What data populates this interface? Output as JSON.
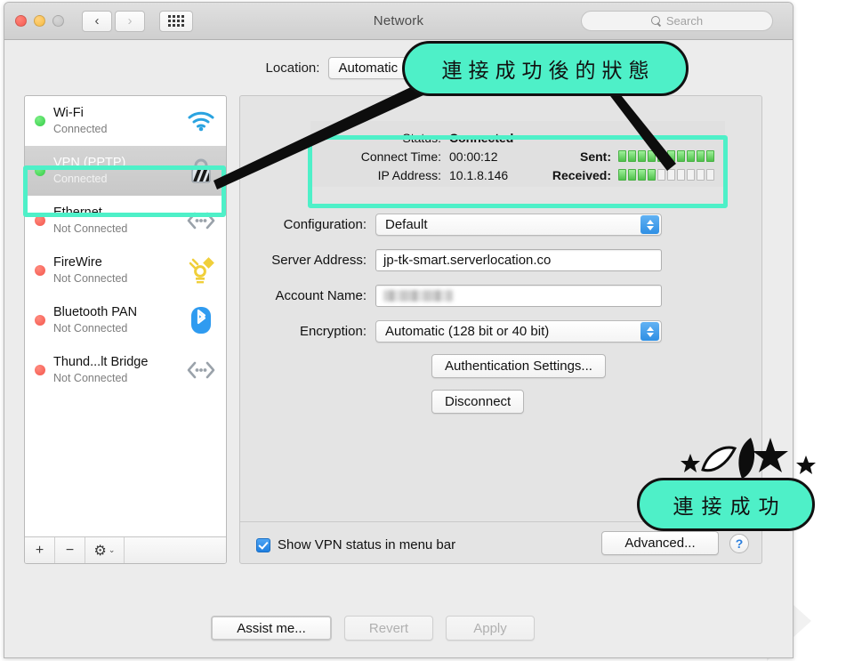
{
  "window": {
    "title": "Network",
    "traffic_lights": [
      "close",
      "minimize",
      "zoom-disabled"
    ],
    "nav_back": "‹",
    "nav_forward": "›",
    "show_all_icon": "grid-icon"
  },
  "search": {
    "placeholder": "Search",
    "icon": "search-icon"
  },
  "location": {
    "label": "Location:",
    "value": "Automatic"
  },
  "sidebar": {
    "items": [
      {
        "name": "Wi-Fi",
        "status": "Connected",
        "led": "green",
        "icon": "wifi-icon",
        "selected": false
      },
      {
        "name": "VPN (PPTP)",
        "status": "Connected",
        "led": "green",
        "icon": "lock-icon",
        "selected": true
      },
      {
        "name": "Ethernet",
        "status": "Not Connected",
        "led": "red",
        "icon": "ethernet-icon",
        "selected": false
      },
      {
        "name": "FireWire",
        "status": "Not Connected",
        "led": "red",
        "icon": "firewire-icon",
        "selected": false
      },
      {
        "name": "Bluetooth PAN",
        "status": "Not Connected",
        "led": "red",
        "icon": "bluetooth-icon",
        "selected": false
      },
      {
        "name": "Thund...lt Bridge",
        "status": "Not Connected",
        "led": "red",
        "icon": "ethernet-icon",
        "selected": false
      }
    ],
    "footer": {
      "add": "+",
      "remove": "−",
      "gear": "⚙",
      "chevron": "⌄"
    }
  },
  "status_panel": {
    "status_label": "Status:",
    "status_value": "Connected",
    "connect_time_label": "Connect Time:",
    "connect_time_value": "00:00:12",
    "ip_label": "IP Address:",
    "ip_value": "10.1.8.146",
    "sent_label": "Sent:",
    "sent_segments_total": 10,
    "sent_segments_filled": 10,
    "received_label": "Received:",
    "received_segments_total": 10,
    "received_segments_filled": 4
  },
  "form": {
    "configuration_label": "Configuration:",
    "configuration_value": "Default",
    "server_label": "Server Address:",
    "server_value": "jp-tk-smart.serverlocation.co",
    "account_label": "Account Name:",
    "account_value": "",
    "encryption_label": "Encryption:",
    "encryption_value": "Automatic (128 bit or 40 bit)",
    "auth_button": "Authentication Settings...",
    "disconnect_button": "Disconnect"
  },
  "panel_bottom": {
    "checkbox_label": "Show VPN status in menu bar",
    "checkbox_checked": true,
    "advanced_button": "Advanced...",
    "help_button": "?"
  },
  "footer": {
    "assist_button": "Assist me...",
    "revert_button": "Revert",
    "apply_button": "Apply",
    "revert_disabled": true,
    "apply_disabled": true
  },
  "annotations": {
    "top_callout": "連接成功後的狀態",
    "bottom_callout": "連接成功",
    "accent_color": "#4ef0c8"
  }
}
